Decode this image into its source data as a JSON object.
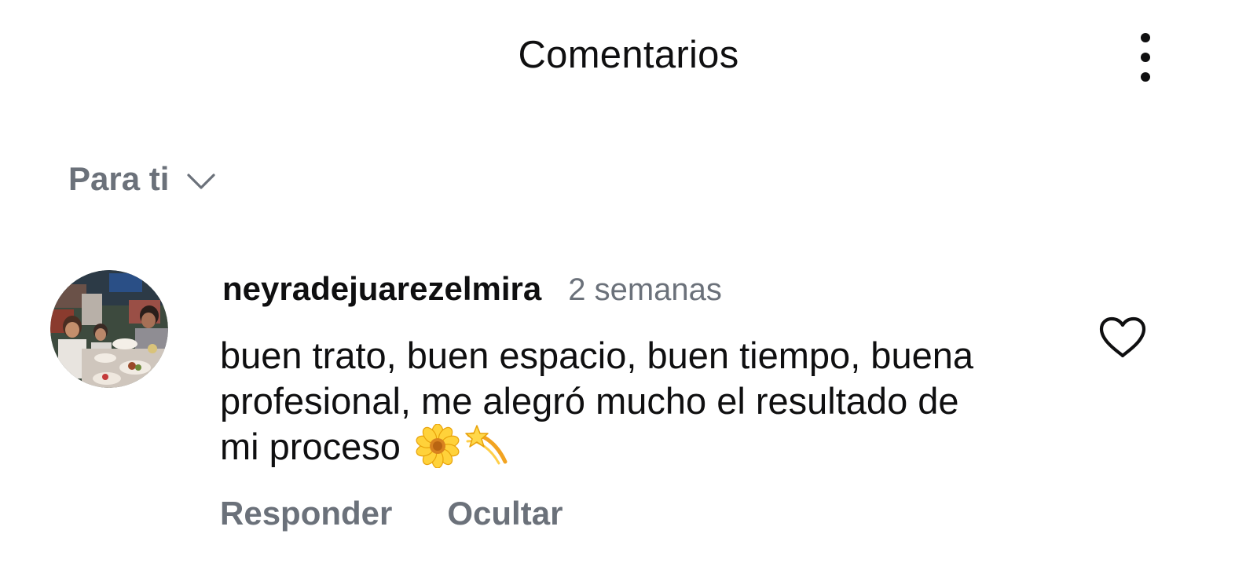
{
  "header": {
    "title": "Comentarios",
    "more_icon": "more-vertical-icon"
  },
  "sort": {
    "label": "Para ti",
    "icon": "chevron-down-icon"
  },
  "comment": {
    "username": "neyradejuarezelmira",
    "timestamp": "2 semanas",
    "text": "buen trato, buen espacio, buen tiempo, buena profesional, me alegró mucho el resultado de mi proceso",
    "emojis": [
      "blossom-emoji",
      "dizzy-star-emoji"
    ],
    "like_icon": "heart-outline-icon",
    "actions": {
      "reply": "Responder",
      "hide": "Ocultar"
    }
  },
  "colors": {
    "primary_text": "#0f0f10",
    "secondary_text": "#6b717a",
    "background": "#ffffff"
  }
}
